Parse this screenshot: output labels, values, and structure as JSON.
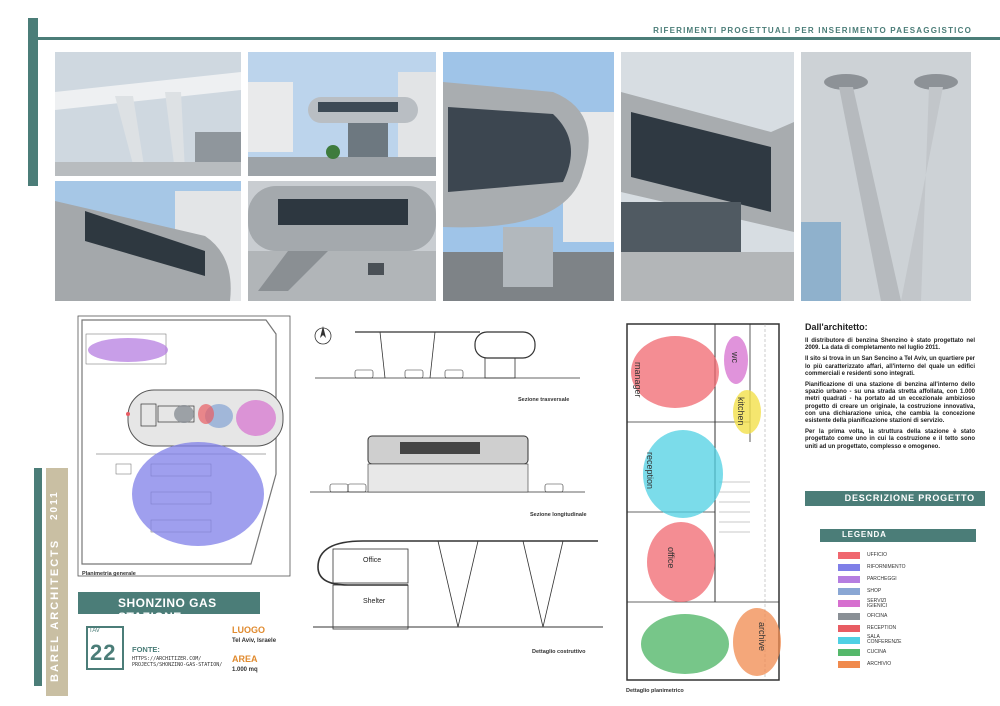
{
  "header": {
    "title": "RIFERIMENTI PROGETTUALI PER INSERIMENTO PAESAGGISTICO"
  },
  "colors": {
    "accent": "#4b7d78",
    "beige": "#c9bfa3",
    "orange_label": "#e08a2e"
  },
  "sidebar": {
    "studio": "BAREL ARCHITECTS",
    "year": "2011"
  },
  "plans": {
    "site_caption": "Planimetria generale",
    "section_transverse": "Sezione trasversale",
    "section_longitudinal": "Sezione longitudinale",
    "detail_construction": "Dettaglio costruttivo",
    "detail_plan": "Dettaglio planimetrico",
    "detail_labels": {
      "office": "Office",
      "shelter": "Shelter"
    },
    "plan_labels": {
      "manager": "manager",
      "wc": "wc",
      "kitchen": "kitchen",
      "reception": "reception",
      "office": "office",
      "archive": "archive"
    }
  },
  "project": {
    "title": "SHONZINO GAS STAZIONE",
    "tav_label": "TAV",
    "tav_number": "22",
    "fonte_label": "FONTE:",
    "fonte_url_1": "HTTPS://ARCHITIZER.COM/",
    "fonte_url_2": "PROJECTS/SHONZINO-GAS-STATION/",
    "luogo_label": "LUOGO",
    "luogo_value": "Tel Aviv, Israele",
    "area_label": "AREA",
    "area_value": "1.000 mq"
  },
  "description": {
    "heading": "Dall'architetto:",
    "paragraphs": [
      "Il distributore di benzina Shenzino è stato progettato nel 2009. La data di completamento nel luglio 2011.",
      "Il sito si trova in un San Sencino a Tel Aviv, un quartiere per lo più caratterizzato affari, all'interno del quale un edifici commerciali e residenti sono integrati.",
      "Pianificazione di una stazione di benzina all'interno dello spazio urbano - su una strada stretta affollata, con 1.000 metri quadrati - ha portato ad un eccezionale ambizioso progetto di creare un originale, la costruzione innovativa, con una dichiarazione unica, che cambia la concezione esistente della pianificazione stazioni di servizio.",
      "Per la prima volta, la struttura della stazione è stato progettato come uno in cui la costruzione e il tetto sono uniti ad un progettato, complesso e omogeneo."
    ],
    "bar_label": "DESCRIZIONE PROGETTO"
  },
  "legend": {
    "title": "LEGENDA",
    "items": [
      {
        "label": "UFFICIO",
        "color": "#f0676f"
      },
      {
        "label": "RIFORNIMENTO",
        "color": "#7f7fe8"
      },
      {
        "label": "PARCHEGGI",
        "color": "#b57ee0"
      },
      {
        "label": "SHOP",
        "color": "#8aa7d4"
      },
      {
        "label": "SERVIZI IGIENICI",
        "color": "#d66fcf"
      },
      {
        "label": "OFICINA",
        "color": "#8a9096"
      },
      {
        "label": "RECEPTION",
        "color": "#e85c63"
      },
      {
        "label": "SALA CONFERENZE",
        "color": "#4fd0e3"
      },
      {
        "label": "CUCINA",
        "color": "#55b86b"
      },
      {
        "label": "ARCHIVIO",
        "color": "#f08a4d"
      }
    ]
  }
}
